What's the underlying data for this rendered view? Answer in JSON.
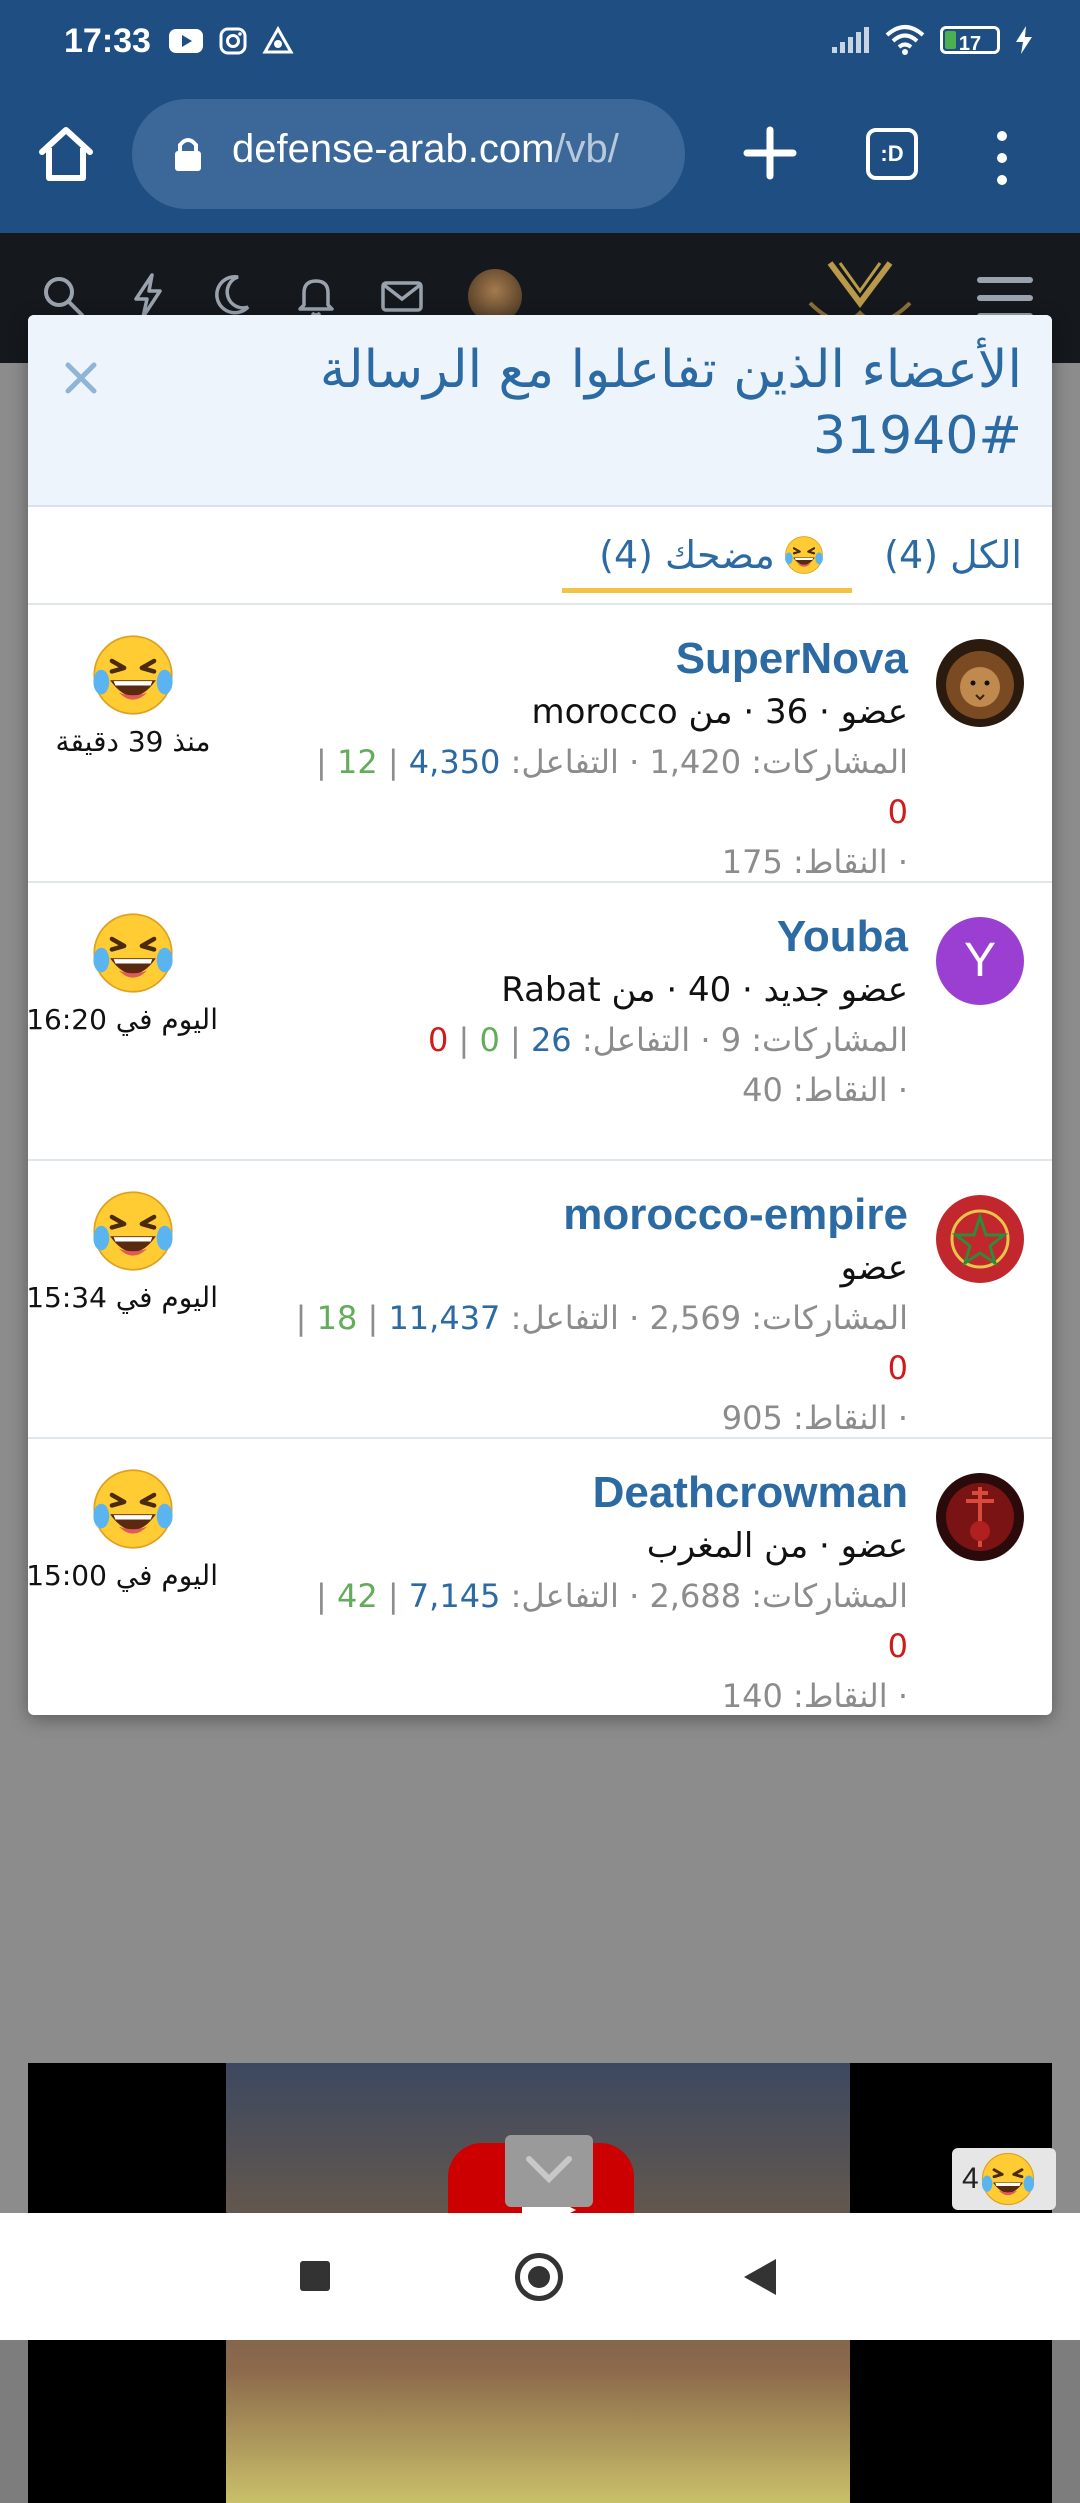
{
  "status_bar": {
    "time": "17:33",
    "battery": "17"
  },
  "browser": {
    "url_domain": "defense-arab.com",
    "url_path": "/vb/",
    "tab_label": ":D"
  },
  "modal": {
    "title": "الأعضاء الذين تفاعلوا مع الرسالة #31940",
    "tabs": [
      {
        "label": "الكل (4)"
      },
      {
        "label": "مضحك (4)",
        "active": true
      }
    ],
    "members": [
      {
        "name": "SuperNova",
        "blurb": "عضو · 36 · من morocco",
        "stats_prefix": "المشاركات: 1,420 · التفاعل: ",
        "reaction_score": "4,350",
        "sep1": " | ",
        "positive": "12",
        "sep2": " | ",
        "negative": "0",
        "points": "· النقاط: 175",
        "reaction_time": "منذ 39 دقيقة",
        "avatar": "lion"
      },
      {
        "name": "Youba",
        "avatar_letter": "Y",
        "blurb": "عضو جديد · 40 · من Rabat",
        "stats_prefix": "المشاركات: 9 · التفاعل: ",
        "reaction_score": "26",
        "sep1": " | ",
        "positive": "0",
        "sep2": " | ",
        "negative": "0",
        "points": "· النقاط: 40",
        "reaction_time": "اليوم في 16:20"
      },
      {
        "name": "morocco-empire",
        "blurb": "عضو",
        "stats_prefix": "المشاركات: 2,569 · التفاعل: ",
        "reaction_score": "11,437",
        "sep1": " | ",
        "positive": "18",
        "sep2": " | ",
        "negative": "0",
        "points": "· النقاط: 905",
        "reaction_time": "اليوم في 15:34",
        "avatar": "moroccan-flag"
      },
      {
        "name": "Deathcrowman",
        "blurb": "عضو · من المغرب",
        "stats_prefix": "المشاركات: 2,688 · التفاعل: ",
        "reaction_score": "7,145",
        "sep1": " | ",
        "positive": "42",
        "sep2": " | ",
        "negative": "0",
        "points": "· النقاط: 140",
        "reaction_time": "اليوم في 15:00",
        "avatar": "red-figure"
      }
    ]
  },
  "post_footer": {
    "reaction_count": "4"
  },
  "colors": {
    "link_blue": "#2c6aa3",
    "positive_green": "#63ac5a",
    "negative_red": "#d11b1b",
    "tab_underline": "#f5c342",
    "browser_blue": "#1f4f82"
  }
}
